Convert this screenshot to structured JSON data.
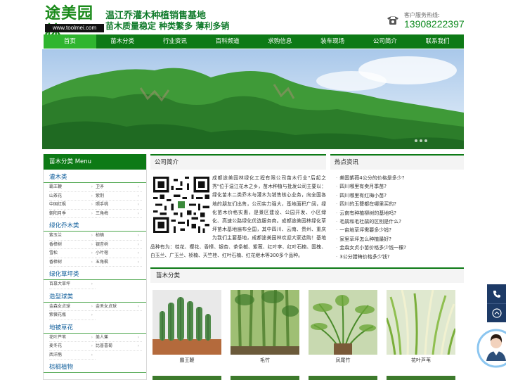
{
  "header": {
    "logo_text": "途美园林",
    "logo_url": "www.toolmei.com",
    "slogan_line1": "温江乔灌木种植销售基地",
    "slogan_line2": "苗木质量稳定  种类繁多  薄利多销",
    "hotline_label": "客户服务热线:",
    "hotline_number": "13908222397"
  },
  "nav": {
    "items": [
      "首页",
      "苗木分类",
      "行业资讯",
      "百科频道",
      "求购信息",
      "装车现场",
      "公司简介",
      "联系我们"
    ],
    "active_index": 0
  },
  "sidebar": {
    "title": "苗木分类 Menu",
    "categories": [
      {
        "name": "灌木类",
        "items": [
          "霸王鞭",
          "卫矛",
          "山茶花",
          "紫荆",
          "中国红枫",
          "照手桃",
          "朝阳月季",
          "三角梅"
        ]
      },
      {
        "name": "绿化乔木类",
        "items": [
          "紫玉兰",
          "桢楠",
          "香樟树",
          "银杏树",
          "雪松",
          "小叶榕",
          "香樟树",
          "五角枫"
        ]
      },
      {
        "name": "绿化草坪类",
        "items": [
          "百慕大草坪"
        ]
      },
      {
        "name": "造型球类",
        "items": [
          "金森女贞球",
          "金禾女贞球",
          "紫薇花瓶"
        ]
      },
      {
        "name": "地被草花",
        "items": [
          "花叶芦苇",
          "美人蕉",
          "麦冬花",
          "比普喜菊",
          "西洋鹃"
        ]
      },
      {
        "name": "棕榈植物",
        "items": []
      }
    ]
  },
  "about": {
    "title": "公司简介",
    "text": "成都途美园林绿化工程有限公司苗木行业\"后起之秀\"位于温江花木之乡，苗木种植与批发公司主要以：绿化苗木二类乔木与灌木为销售核心业务，向全国各地的朋友们出售，公司实力强大，基地面积广阔，绿化苗木价格实惠，是景区建设、公园开发、小区绿化、高速公路绿化优选服务商。成都途美园林绿化草坪苗木基地遍布全国，其中四川、云南、贵州、重庆为我们主要基地，成都途美园林欢迎大家选购！基地品种有为：桂花、樱花、香樟、银杏、茶条槭、紫薇、红叶李、红叶石楠、国槐、白玉兰、广玉兰、桢楠、天竺桂、红叶石楠、红花继木等300多个品种。"
  },
  "news": {
    "title": "热点资讯",
    "items": [
      "美国紫薇4公分的价格是多少?",
      "四川哪里有卖月季苗?",
      "四川哪里有红梅小苗?",
      "四川的玉簪都在哪里买的?",
      "云南有种植柳树的基地吗?",
      "毛鹃和毛杜鹃的区别是什么?",
      "一亩地草坪需要多少钱?",
      "家里草坪怎么种植最好?",
      "金森女贞小苗价格多少钱一棵?",
      "3公分腊梅价格多少钱?"
    ]
  },
  "products": {
    "title": "苗木分类",
    "items": [
      {
        "name": "霸王鞭"
      },
      {
        "name": "毛竹"
      },
      {
        "name": "凤尾竹"
      },
      {
        "name": "花叶芦苇"
      }
    ]
  },
  "colors": {
    "brand_green": "#0d7a16",
    "nav_active": "#2fb52f",
    "category_blue": "#0d5c9a",
    "float_bar": "#1d3a66"
  },
  "icons": {
    "phone": "phone-icon",
    "float_phone": "phone-icon",
    "float_top": "chevron-up-icon"
  }
}
